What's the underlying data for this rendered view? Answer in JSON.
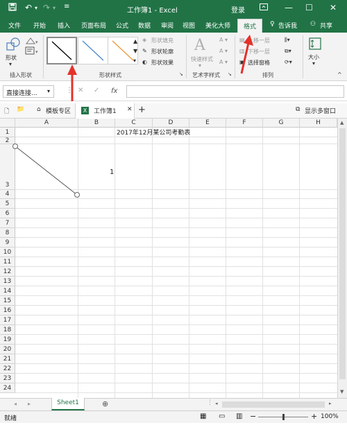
{
  "window": {
    "title": "工作簿1  -  Excel",
    "login_label": "登录"
  },
  "tabs": {
    "file": "文件",
    "home": "开始",
    "insert": "插入",
    "page_layout": "页面布局",
    "formulas": "公式",
    "data": "数据",
    "review": "审阅",
    "view": "视图",
    "beautify": "美化大师",
    "format": "格式",
    "tell_me": "告诉我",
    "share": "共享"
  },
  "ribbon": {
    "shape_label": "形状",
    "insert_shape_group": "插入形状",
    "shape_styles_group": "形状样式",
    "shape_fill": "形状填充",
    "shape_outline": "形状轮廓",
    "shape_effects": "形状效果",
    "quick_styles": "快速样式",
    "wordart_group": "艺术字样式",
    "bring_forward": "上移一层",
    "send_backward": "下移一层",
    "selection_pane": "选择窗格",
    "arrange_group": "排列",
    "size_label": "大小"
  },
  "formula_bar": {
    "name_box": "直接连接...",
    "fx": "fx",
    "value": ""
  },
  "doc_tabs": {
    "template_zone": "模板专区",
    "workbook": "工作簿1",
    "show_windows": "显示多窗口"
  },
  "sheet": {
    "columns": [
      "A",
      "B",
      "C",
      "D",
      "E",
      "F",
      "G",
      "H"
    ],
    "rows": [
      "1",
      "2",
      "3",
      "4",
      "5",
      "6",
      "7",
      "8",
      "9",
      "10",
      "11",
      "12",
      "13",
      "14",
      "15",
      "16",
      "17",
      "18",
      "19",
      "20",
      "21",
      "22",
      "23",
      "24"
    ],
    "title_cell": "2017年12月某公司考勤表",
    "cell_value": "1"
  },
  "sheet_tabs": {
    "active": "Sheet1"
  },
  "status": {
    "ready": "就绪",
    "zoom": "100%"
  },
  "colors": {
    "excel_green": "#217346",
    "annotation_red": "#e5312b"
  }
}
